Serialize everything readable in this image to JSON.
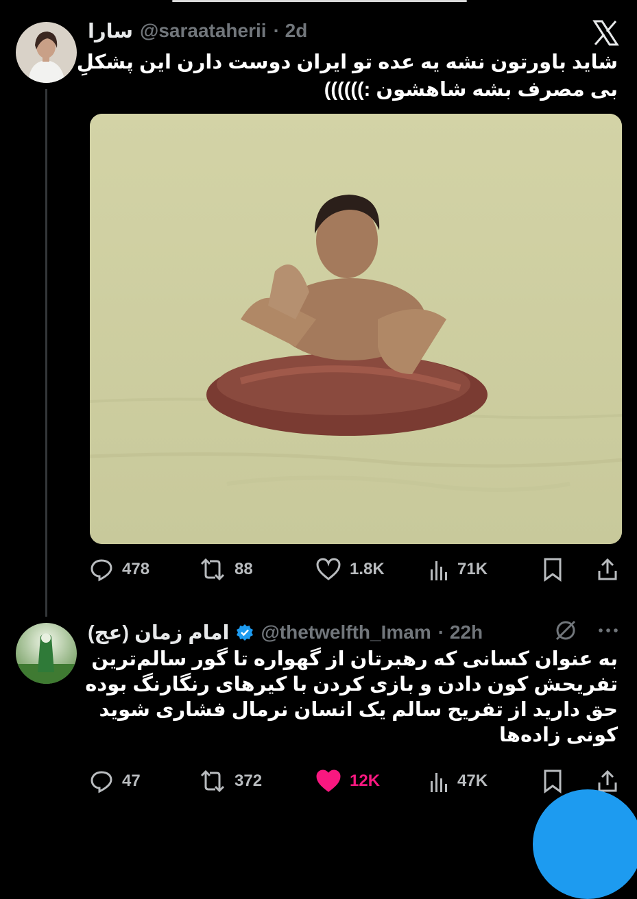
{
  "tweet1": {
    "display_name": "سارا",
    "handle": "@saraataherii",
    "time": "· 2d",
    "text": "شاید باورتون نشه یه عده تو ایران دوست دارن این پشکلِ\nبی مصرف بشه شاهشون :))))))",
    "stats": {
      "replies": "478",
      "reposts": "88",
      "likes": "1.8K",
      "views": "71K"
    }
  },
  "tweet2": {
    "display_name": "امام زمان (عج)",
    "handle": "@thetwelfth_Imam",
    "time": "· 22h",
    "text": "به عنوان کسانی که رهبرتان از گهواره تا گور سالم‌ترین\nتفریحش کون دادن و بازی کردن با کیرهای رنگارنگ بوده\nحق دارید از تفریح سالم یک انسان نرمال فشاری شوید\nکونی زاده‌ها",
    "stats": {
      "replies": "47",
      "reposts": "372",
      "likes": "12K",
      "views": "47K"
    }
  },
  "colors": {
    "background": "#000000",
    "text": "#e7e9ea",
    "muted": "#71767b",
    "like_active": "#f91880",
    "verified": "#1d9bf0"
  },
  "icons": [
    "x-logo-icon",
    "reply-icon",
    "repost-icon",
    "like-icon",
    "views-icon",
    "bookmark-icon",
    "share-icon",
    "verified-icon",
    "grok-icon",
    "more-icon"
  ]
}
